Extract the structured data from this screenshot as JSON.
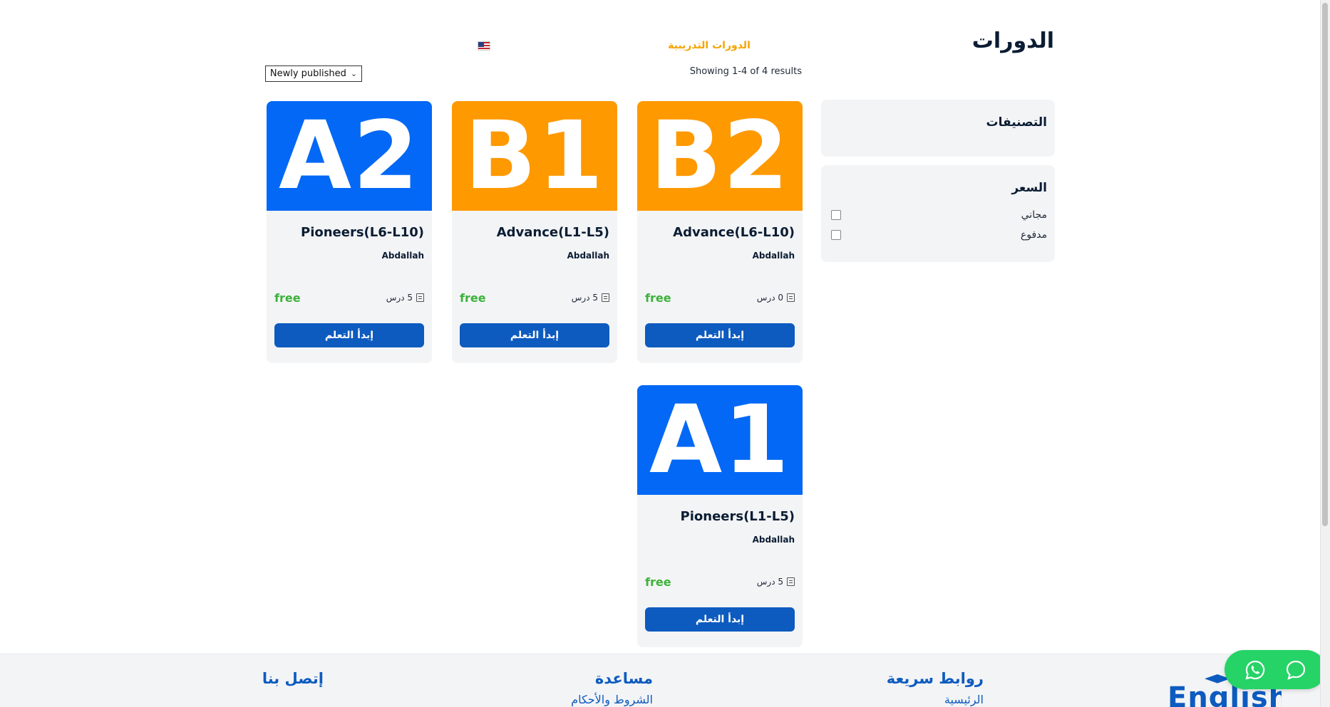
{
  "header": {
    "logo_text": "الدورات",
    "nav_courses": "الدورات التدريبية",
    "language_flag": "us-flag-icon"
  },
  "toolbar": {
    "results_text": "Showing 1-4 of 4 results",
    "sort_selected": "Newly published"
  },
  "sidebar": {
    "categories_title": "التصنيفات",
    "price_title": "السعر",
    "price_options": [
      {
        "label": "مجاني",
        "checked": false
      },
      {
        "label": "مدفوع",
        "checked": false
      }
    ]
  },
  "courses": [
    {
      "badge": "B2",
      "badge_color": "#ff9900",
      "title": "Advance(L6-L10)",
      "author": "Abdallah",
      "lessons": "0 درس",
      "price": "free",
      "button": "إبدأ التعلم"
    },
    {
      "badge": "B1",
      "badge_color": "#ff9900",
      "title": "Advance(L1-L5)",
      "author": "Abdallah",
      "lessons": "5 درس",
      "price": "free",
      "button": "إبدأ التعلم"
    },
    {
      "badge": "A2",
      "badge_color": "#0368f5",
      "title": "Pioneers(L6-L10)",
      "author": "Abdallah",
      "lessons": "5 درس",
      "price": "free",
      "button": "إبدأ التعلم"
    },
    {
      "badge": "A1",
      "badge_color": "#0368f5",
      "title": "Pioneers(L1-L5)",
      "author": "Abdallah",
      "lessons": "5 درس",
      "price": "free",
      "button": "إبدأ التعلم"
    }
  ],
  "footer": {
    "quick_links_title": "روابط سريعة",
    "quick_links_first": "الرئيسية",
    "help_title": "مساعدة",
    "help_first": "الشروط والأحكام",
    "contact_title": "إتصل بنا",
    "brand_text": "English"
  },
  "colors": {
    "accent": "#0d5bbf",
    "nav_highlight": "#f5a300",
    "price_free": "#3cb23a",
    "whatsapp": "#25d366"
  }
}
